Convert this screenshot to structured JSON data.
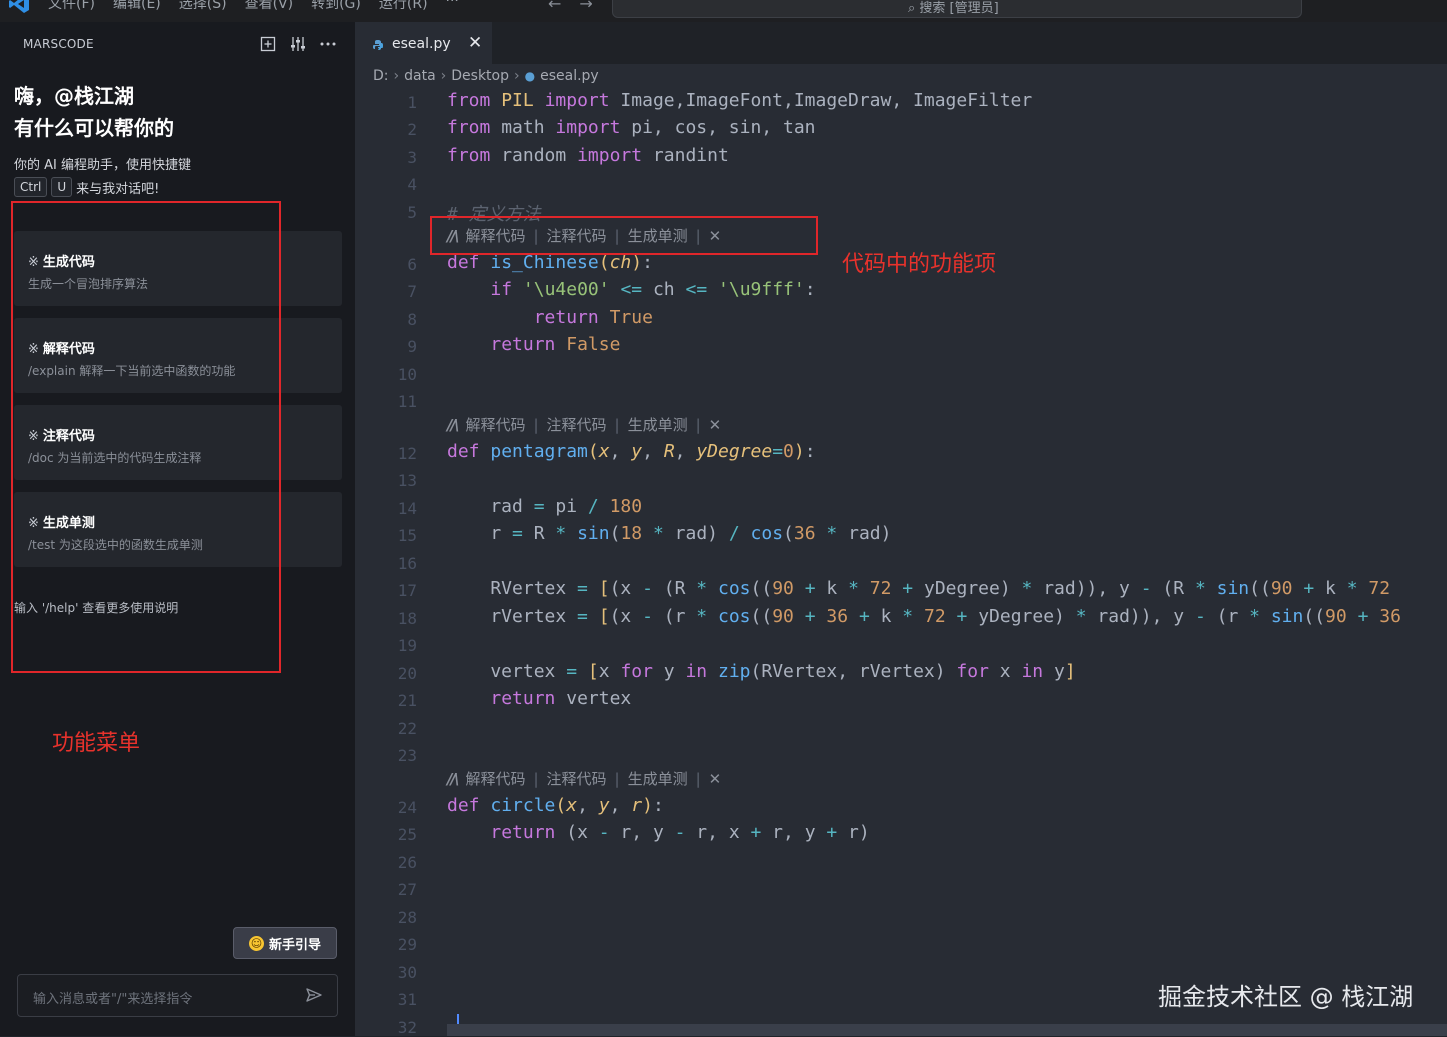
{
  "menubar": {
    "menus": [
      "文件(F)",
      "编辑(E)",
      "选择(S)",
      "查看(V)",
      "转到(G)",
      "运行(R)",
      "···"
    ],
    "back": "←",
    "forward": "→",
    "search_text": "⌕ 搜索 [管理员]"
  },
  "sidebar": {
    "title": "MARSCODE",
    "greeting_line1": "嗨，@栈江湖",
    "greeting_line2": "有什么可以帮你的",
    "intro_line1": "你的 AI 编程助手，使用快捷键",
    "intro_key1": "Ctrl",
    "intro_key2": "U",
    "intro_line2_suffix": "来与我对话吧!",
    "cards": [
      {
        "title": "生成代码",
        "desc": "生成一个冒泡排序算法"
      },
      {
        "title": "解释代码",
        "desc": "/explain 解释一下当前选中函数的功能"
      },
      {
        "title": "注释代码",
        "desc": "/doc 为当前选中的代码生成注释"
      },
      {
        "title": "生成单测",
        "desc": "/test 为这段选中的函数生成单测"
      }
    ],
    "help_text": "输入 '/help' 查看更多使用说明",
    "annotation_label": "功能菜单",
    "guide_button": "新手引导",
    "chat_placeholder": "输入消息或者\"/\"来选择指令"
  },
  "editor": {
    "tab_label": "eseal.py",
    "tab_close": "✕",
    "breadcrumb": [
      "D:",
      "data",
      "Desktop",
      "eseal.py"
    ],
    "codelens": {
      "explain": "解释代码",
      "comment": "注释代码",
      "test": "生成单测",
      "close": "✕",
      "separator": "|"
    },
    "annotation_label": "代码中的功能项",
    "line_numbers": [
      "1",
      "2",
      "3",
      "4",
      "5",
      "6",
      "7",
      "8",
      "9",
      "10",
      "11",
      "12",
      "13",
      "14",
      "15",
      "16",
      "17",
      "18",
      "19",
      "20",
      "21",
      "22",
      "23",
      "24",
      "25",
      "26",
      "27",
      "28",
      "29",
      "30",
      "31",
      "32"
    ]
  },
  "watermark": "掘金技术社区 @ 栈江湖",
  "colors": {
    "annotation_red": "#e0262a",
    "editor_bg": "#282c34",
    "sidebar_bg": "#181a1f"
  }
}
